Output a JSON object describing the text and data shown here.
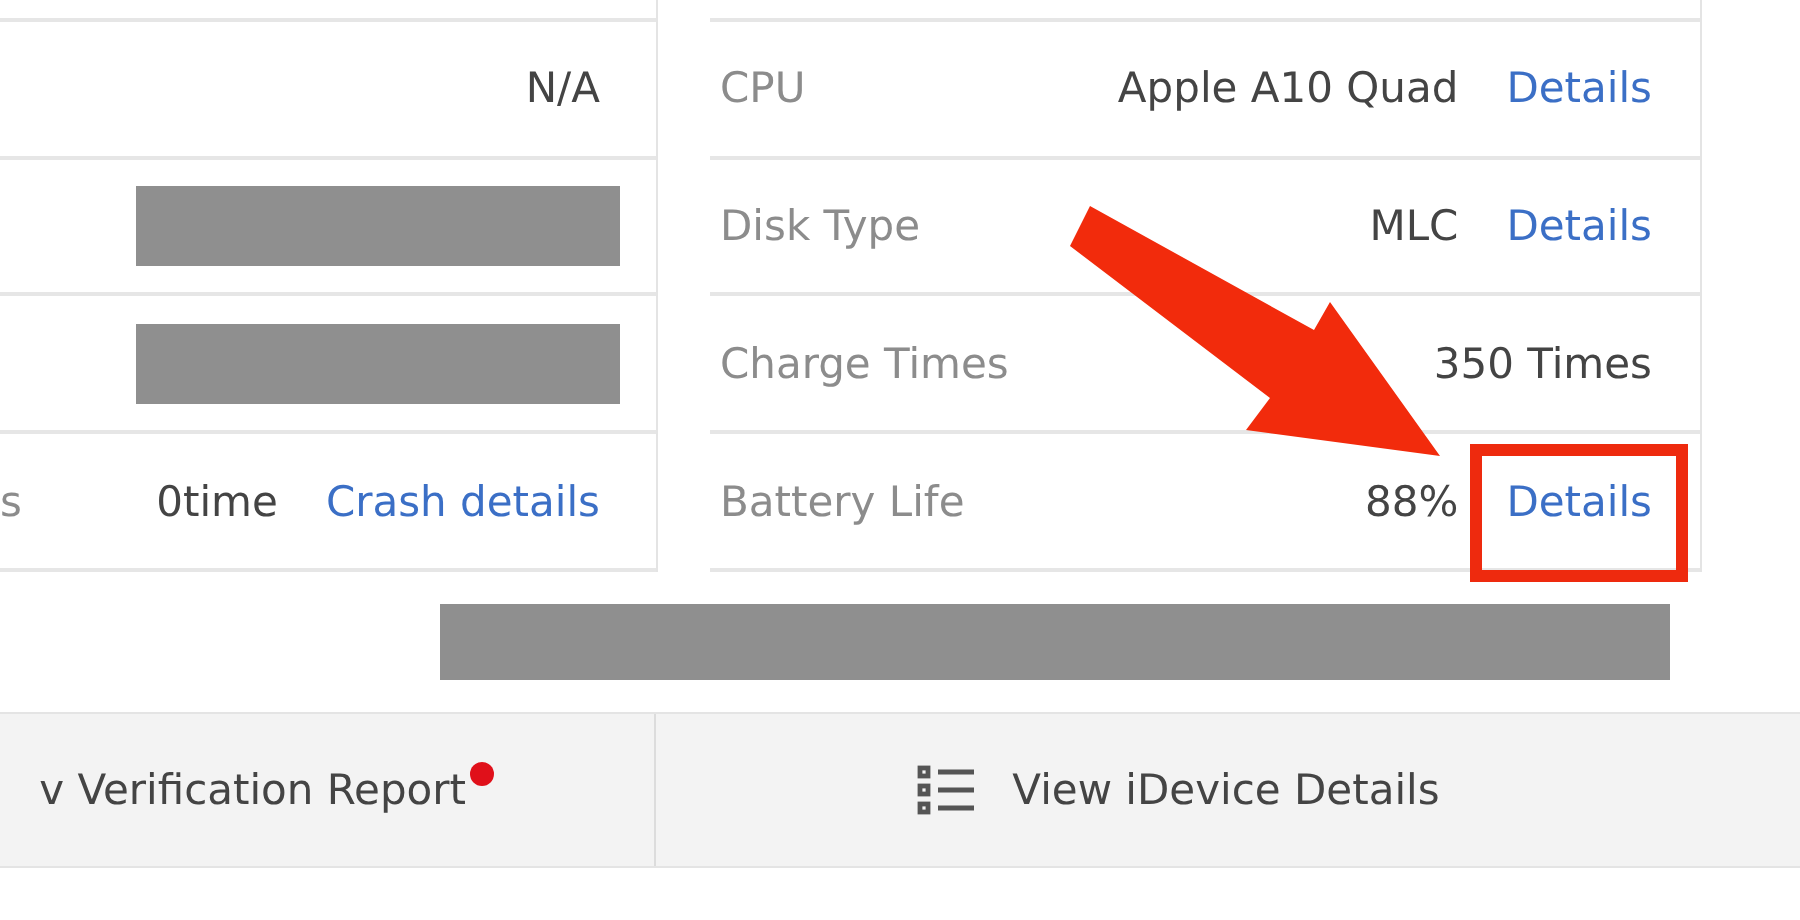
{
  "left_rows": [
    {
      "value": "N/A"
    },
    {
      "redacted": true
    },
    {
      "redacted": true
    },
    {
      "label": "s",
      "value": "0time",
      "link": "Crash details"
    }
  ],
  "right_rows": [
    {
      "label": "CPU",
      "value": "Apple A10 Quad",
      "link": "Details"
    },
    {
      "label": "Disk Type",
      "value": "MLC",
      "link": "Details"
    },
    {
      "label": "Charge Times",
      "value": "350 Times"
    },
    {
      "label": "Battery Life",
      "value": "88%",
      "link": "Details"
    }
  ],
  "annotations": {
    "arrow": true,
    "highlight_box": true
  },
  "wide_row": {
    "redacted": true
  },
  "buttons": [
    {
      "label": "v Verification Report",
      "kind": "badge"
    },
    {
      "label": "View iDevice Details",
      "kind": "list-icon"
    }
  ]
}
